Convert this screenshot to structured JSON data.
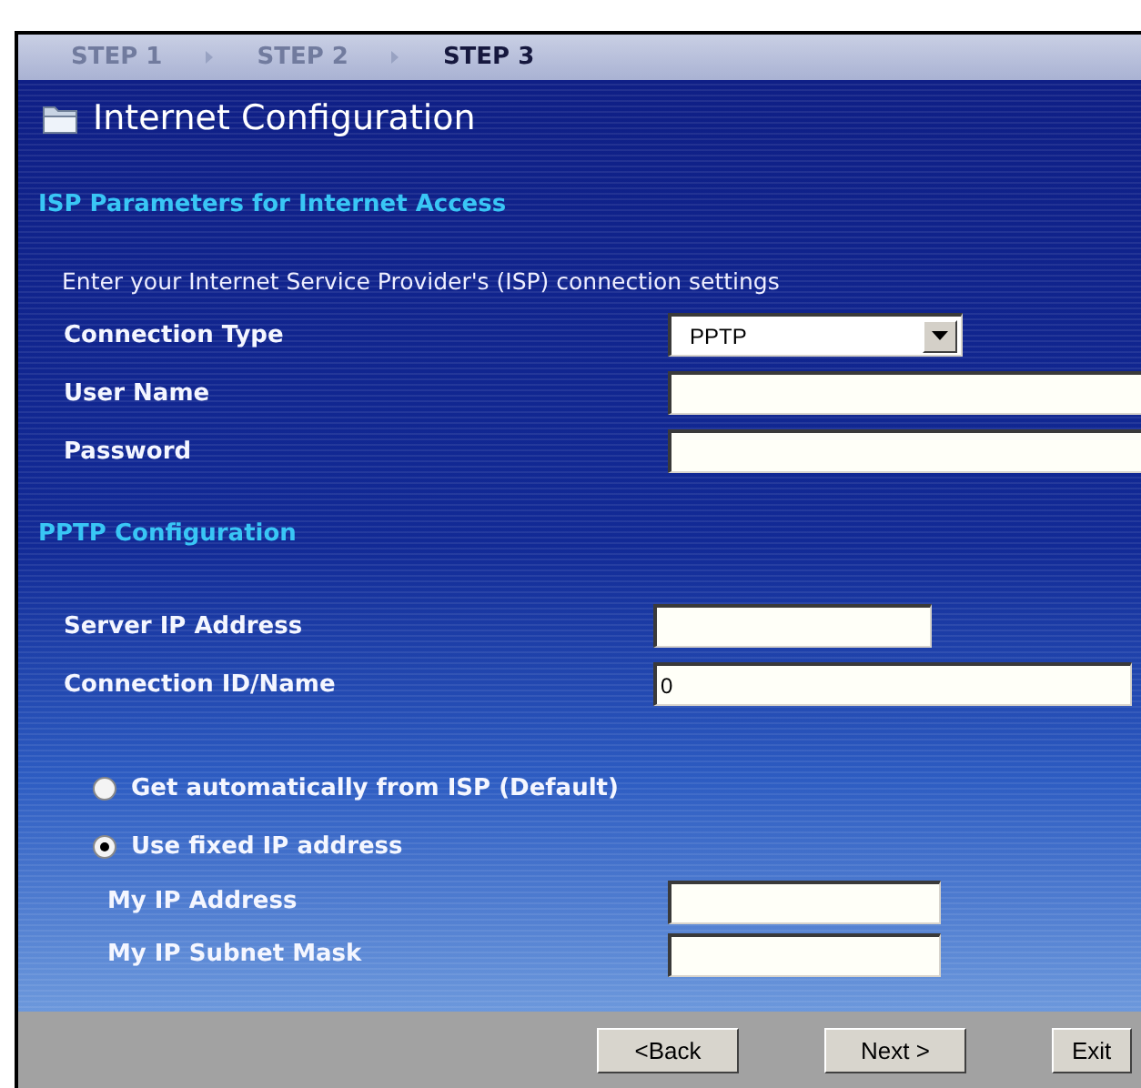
{
  "steps": [
    {
      "label": "STEP 1",
      "selected": false
    },
    {
      "label": "STEP 2",
      "selected": false
    },
    {
      "label": "STEP 3",
      "selected": true
    }
  ],
  "title": "Internet Configuration",
  "sections": [
    {
      "heading": "ISP Parameters for Internet Access",
      "intro": "Enter your Internet Service Provider's (ISP) connection settings",
      "fields": [
        {
          "kind": "select",
          "label": "Connection Type",
          "value": "PPTP"
        },
        {
          "kind": "text",
          "label": "User Name"
        },
        {
          "kind": "password",
          "label": "Password"
        }
      ]
    },
    {
      "heading": "PPTP Configuration",
      "fields": [
        {
          "kind": "short",
          "label": "Server IP Address"
        },
        {
          "kind": "text",
          "label": "Connection ID/Name",
          "value": "0"
        }
      ]
    }
  ],
  "ip_options": [
    {
      "label": "Get automatically from ISP (Default)",
      "selected": false
    },
    {
      "label": "Use fixed IP address",
      "selected": true
    }
  ],
  "fixed_ip_fields": [
    {
      "label": "My IP Address"
    },
    {
      "label": "My IP Subnet Mask"
    }
  ],
  "buttons": [
    "<Back",
    "Next >",
    "Exit"
  ]
}
